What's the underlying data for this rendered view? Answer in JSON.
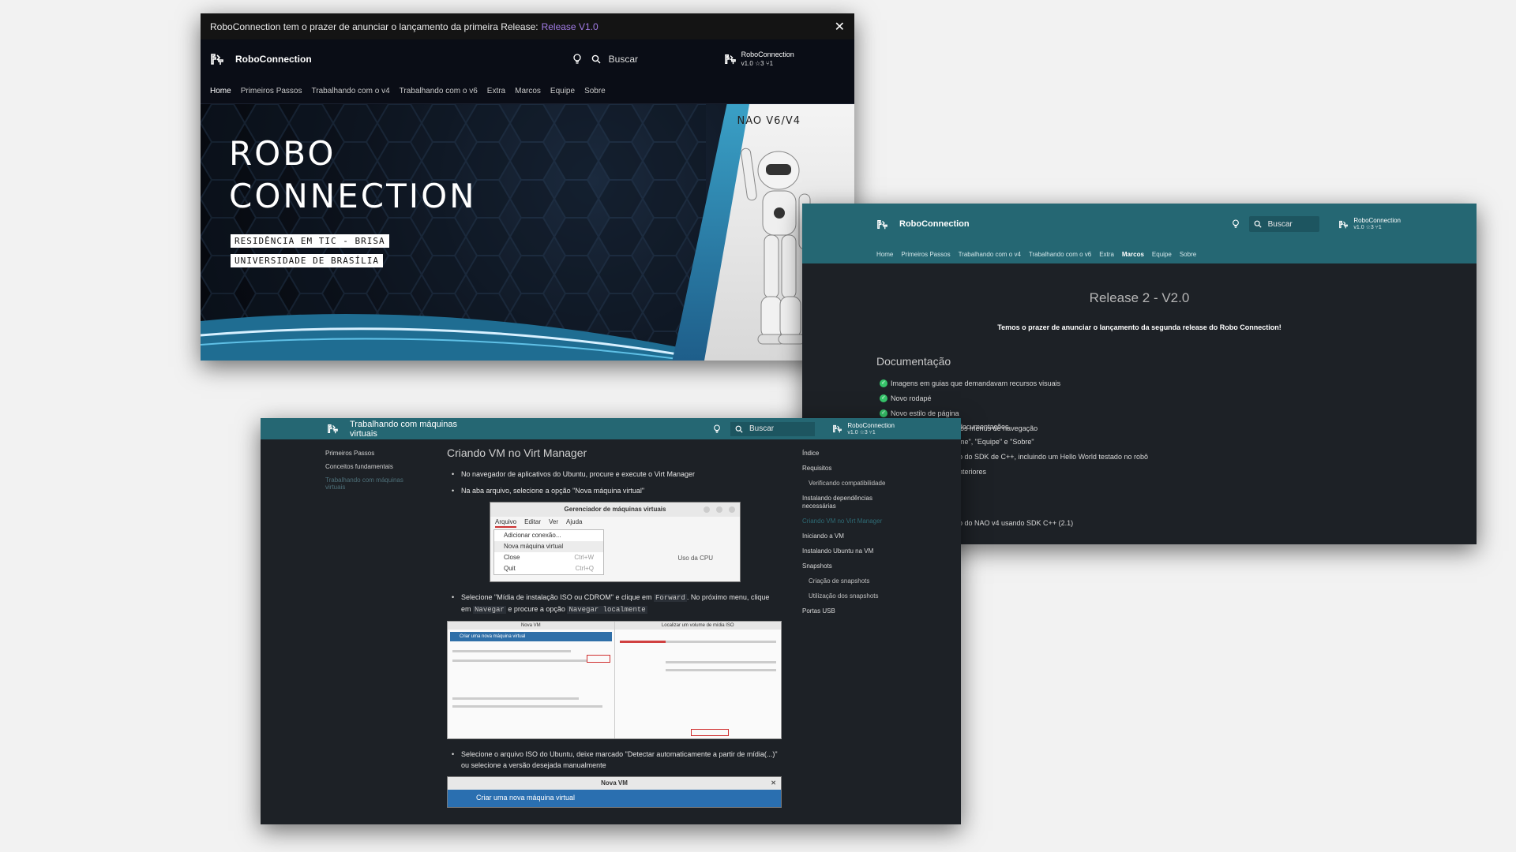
{
  "window1": {
    "announcement": {
      "text": "RoboConnection tem o prazer de anunciar o lançamento da primeira Release:",
      "link": "Release V1.0",
      "close": "✕"
    },
    "header": {
      "site_name": "RoboConnection",
      "search_placeholder": "Buscar",
      "repo_name": "RoboConnection",
      "repo_stats": "v1.0 ☆3 ⑂1"
    },
    "tabs": [
      "Home",
      "Primeiros Passos",
      "Trabalhando com o v4",
      "Trabalhando com o v6",
      "Extra",
      "Marcos",
      "Equipe",
      "Sobre"
    ],
    "hero": {
      "title_line1": "ROBO",
      "title_line2": "CONNECTION",
      "tag1": "RESIDÊNCIA EM TIC - BRISA",
      "tag2": "UNIVERSIDADE DE BRASÍLIA",
      "robot_label": "NAO V6/V4"
    }
  },
  "window2": {
    "header": {
      "site_name": "RoboConnection",
      "search_placeholder": "Buscar",
      "repo_name": "RoboConnection",
      "repo_stats": "v1.0 ☆3 ⑂1"
    },
    "tabs": [
      "Home",
      "Primeiros Passos",
      "Trabalhando com o v4",
      "Trabalhando com o v6",
      "Extra",
      "Marcos",
      "Equipe",
      "Sobre"
    ],
    "title": "Release 2 - V2.0",
    "subtitle": "Temos o prazer de anunciar o lançamento da segunda release do Robo Connection!",
    "doc_heading": "Documentação",
    "doc_items": [
      "Imagens em guias que demandavam recursos visuais",
      "Novo rodapé",
      "Novo estilo de página",
      "Setorização intuitiva dos menus de navegação"
    ],
    "partial_lines": [
      "documentações",
      "me\", \"Equipe\" e \"Sobre\"",
      "o do SDK de C++, incluindo um Hello World testado no robô",
      "nteriores",
      "o do NAO v4 usando SDK C++ (2.1)"
    ]
  },
  "window3": {
    "header": {
      "page_title": "Trabalhando com máquinas virtuais",
      "search_placeholder": "Buscar",
      "repo_name": "RoboConnection",
      "repo_stats": "v1.0 ☆3 ⑂1"
    },
    "sidebar": [
      "Primeiros Passos",
      "Conceitos fundamentais",
      "Trabalhando com máquinas virtuais"
    ],
    "content": {
      "heading": "Criando VM no Virt Manager",
      "bullet1": "No navegador de aplicativos do Ubuntu, procure e execute o Virt Manager",
      "bullet2": "Na aba arquivo, selecione a opção \"Nova máquina virtual\"",
      "bullet3_a": "Selecione \"Mídia de instalação ISO ou CDROM\" e clique em",
      "bullet3_code1": "Forward",
      "bullet3_b": ". No próximo menu, clique em",
      "bullet3_code2": "Navegar",
      "bullet3_c": "e procure a opção",
      "bullet3_code3": "Navegar localmente",
      "bullet4": "Selecione o arquivo ISO do Ubuntu, deixe marcado \"Detectar automaticamente a partir de mídia(...)\" ou selecione a versão desejada manualmente"
    },
    "img1": {
      "title": "Gerenciador de máquinas virtuais",
      "menus": [
        "Arquivo",
        "Editar",
        "Ver",
        "Ajuda"
      ],
      "items": [
        {
          "label": "Adicionar conexão...",
          "key": ""
        },
        {
          "label": "Nova máquina virtual",
          "key": ""
        },
        {
          "label": "Close",
          "key": "Ctrl+W"
        },
        {
          "label": "Quit",
          "key": "Ctrl+Q"
        }
      ],
      "cpu_label": "Uso da CPU"
    },
    "img2": {
      "left_title": "Nova VM",
      "left_bar": "Criar uma nova máquina virtual",
      "right_title": "Localizar um volume de mídia ISO"
    },
    "img3": {
      "title": "Nova VM",
      "bar": "Criar uma nova máquina virtual",
      "close": "✕"
    },
    "toc": [
      {
        "label": "Índice",
        "level": 0
      },
      {
        "label": "Requisitos",
        "level": 0
      },
      {
        "label": "Verificando compatibilidade",
        "level": 1
      },
      {
        "label": "Instalando dependências necessárias",
        "level": 0
      },
      {
        "label": "Criando VM no Virt Manager",
        "level": 0,
        "current": true
      },
      {
        "label": "Iniciando a VM",
        "level": 0
      },
      {
        "label": "Instalando Ubuntu na VM",
        "level": 0
      },
      {
        "label": "Snapshots",
        "level": 0
      },
      {
        "label": "Criação de snapshots",
        "level": 1
      },
      {
        "label": "Utilização dos snapshots",
        "level": 1
      },
      {
        "label": "Portas USB",
        "level": 0
      }
    ]
  },
  "colors": {
    "accent_link": "#a27ce6",
    "teal_header": "#256773",
    "dark_bg": "#1d2126",
    "check_green": "#36c36a"
  }
}
